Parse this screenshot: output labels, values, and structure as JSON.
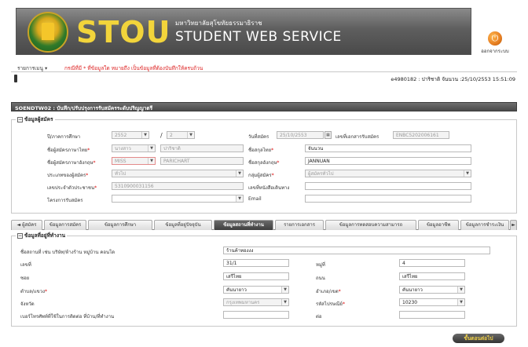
{
  "header": {
    "brand_short": "STOU",
    "brand_thai": "มหาวิทยาลัยสุโขทัยธรรมาธิราช",
    "brand_en": "STUDENT WEB SERVICE",
    "logout_label": "ออกจากระบบ",
    "logout_icon": "power-icon"
  },
  "menubar": {
    "menu_label": "รายการเมนู ▾",
    "notice": "กรณีที่มี * ที่ข้อมูลใด หมายถึง เป็นข้อมูลที่ต้องบันทึกให้ครบถ้วน"
  },
  "user_info": "e4980182 : ปาริชาติ จันนวน :25/10/2553 15:51:09",
  "page_title": "SOENDTW02 : บันทึก/ปรับปรุงการรับสมัครระดับปริญญาตรี",
  "applicant": {
    "legend": "ข้อมูลผู้สมัคร",
    "toggle": "−",
    "year_label": "ปี/ภาคการศึกษา",
    "year_value": "2552",
    "term_value": "2",
    "slash": "/",
    "apply_date_label": "วันที่สมัคร",
    "apply_date_value": "25/10/2553",
    "doc_no_label": "เลขที่เอกสารรับสมัคร",
    "doc_no_value": "ENBC5202006161",
    "th_name_label": "ชื่อผู้สมัครภาษาไทย",
    "th_title_value": "นางสาว",
    "th_name_value": "ปาริชาติ",
    "th_surname_label": "ชื่อสกุลไทย",
    "th_surname_value": "จันนวน",
    "en_name_label": "ชื่อผู้สมัครภาษาอังกฤษ",
    "en_title_value": "MISS",
    "en_name_value": "PARICHART",
    "en_surname_label": "ชื่อสกุลอังกฤษ",
    "en_surname_value": "JANNUAN",
    "type_label": "ประเภทของผู้สมัคร",
    "type_value": "ทั่วไป",
    "group_label": "กลุ่มผู้สมัคร",
    "group_value": "ผู้สมัครทั่วไป",
    "id_label": "เลขประจำตัวประชาชน",
    "id_value": "5310900031156",
    "passport_label": "เลขที่หนังสือเดินทาง",
    "project_label": "โครงการรับสมัคร",
    "email_label": "Email"
  },
  "tabs": [
    {
      "label": "◄ ผู้สมัคร"
    },
    {
      "label": "ข้อมูลการสมัคร"
    },
    {
      "label": "ข้อมูลการศึกษา"
    },
    {
      "label": "ข้อมูลที่อยู่ปัจจุบัน"
    },
    {
      "label": "ข้อมูลสถานที่ทำงาน"
    },
    {
      "label": "รายการเอกสาร"
    },
    {
      "label": "ข้อมูลการทดสอบความสามารถ"
    },
    {
      "label": "ข้อมูลอาชีพ"
    },
    {
      "label": "ข้อมูลการชำระเงิน"
    },
    {
      "label": "►"
    }
  ],
  "workplace": {
    "legend": "ข้อมูลที่อยู่ที่ทำงาน",
    "toggle": "−",
    "place_label": "ชื่อสถานที่ เช่น บริษัท/ห้างร้าน หมู่บ้าน คอนโด",
    "place_value": "ร้านค้าทองงง",
    "house_no_label": "เลขที่",
    "house_no_value": "31/1",
    "moo_label": "หมู่ที่",
    "moo_value": "4",
    "soi_label": "ซอย",
    "soi_value": "เสรีไทย",
    "road_label": "ถนน",
    "road_value": "เสรีไทย",
    "subdistrict_label": "ตำบล/แขวง",
    "subdistrict_value": "คันนายาว",
    "district_label": "อำเภอ/เขต",
    "district_value": "คันนายาว",
    "province_label": "จังหวัด",
    "province_value": "กรุงเทพมหานคร",
    "postal_label": "รหัสไปรษณีย์",
    "postal_value": "10230",
    "phone_label": "เบอร์โทรศัพท์ที่ใช้ในการติดต่อ ที่บ้าน/ที่ทำงาน",
    "ext_label": "ต่อ"
  },
  "next_label": "ขั้นตอนต่อไป"
}
